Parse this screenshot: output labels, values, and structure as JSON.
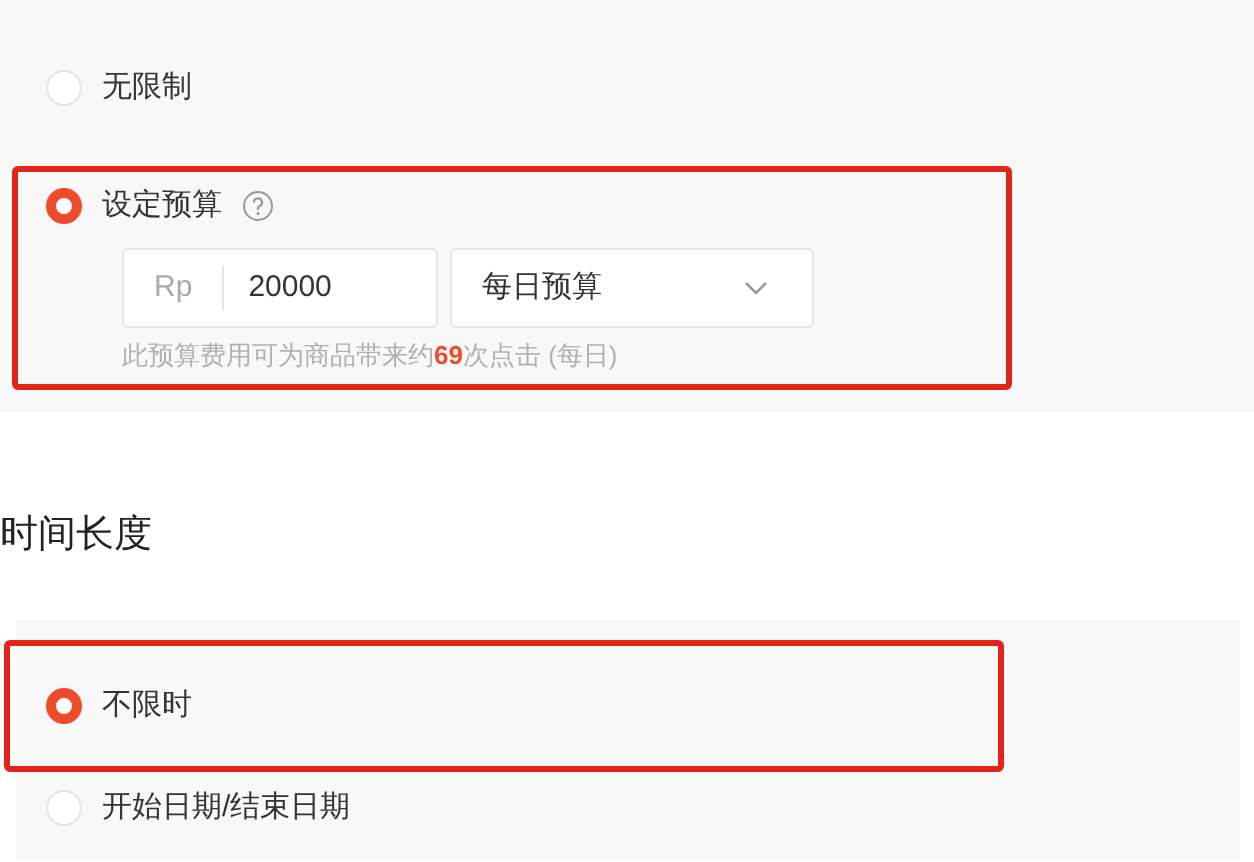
{
  "budget": {
    "options": [
      {
        "label": "无限制",
        "selected": false,
        "highlighted": false
      },
      {
        "label": "设定预算",
        "selected": true,
        "highlighted": true,
        "help_icon": true,
        "currency": "Rp",
        "amount": "20000",
        "period": "每日预算",
        "hint": "此预算费用可为商品带来约**69**次点击 (每日)"
      }
    ]
  },
  "duration": {
    "title": "时间长度",
    "options": [
      {
        "label": "不限时",
        "selected": true,
        "highlighted": true
      },
      {
        "label": "开始日期/结束日期",
        "selected": false,
        "highlighted": false
      }
    ]
  }
}
